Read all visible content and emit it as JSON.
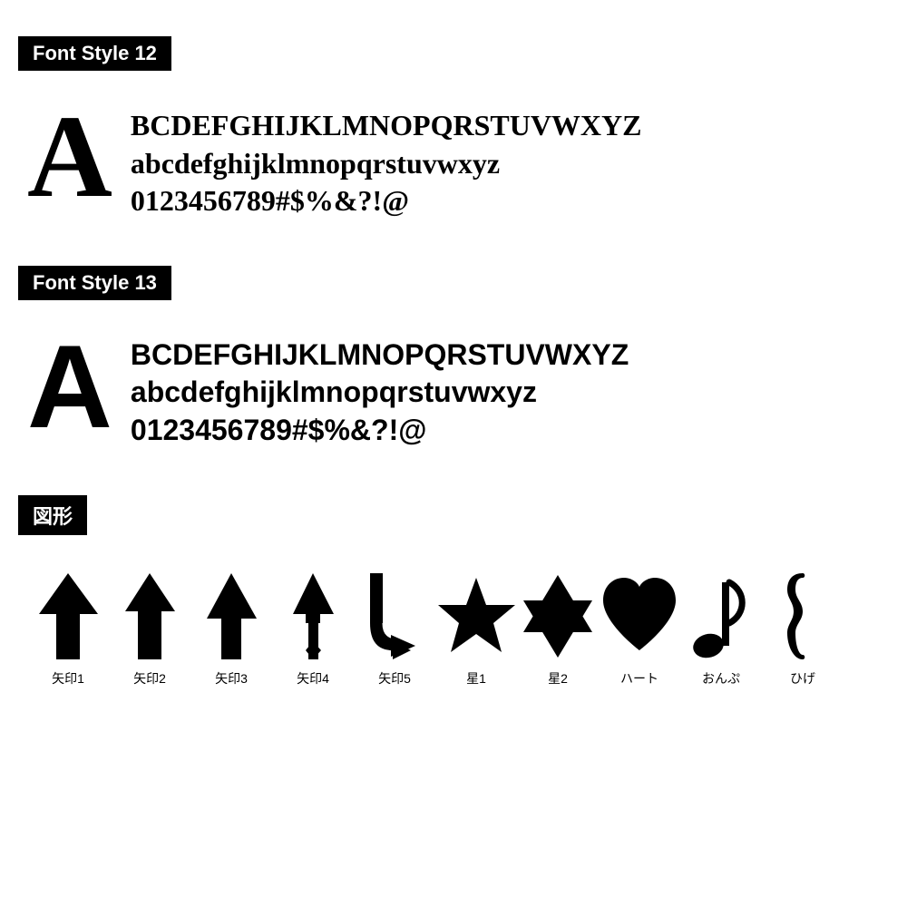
{
  "font_style_12": {
    "label": "Font Style 12",
    "big_letter": "A",
    "lines": [
      "BCDEFGHIJKLMNOPQRSTUVWXYZ",
      "abcdefghijklmnopqrstuvwxyz",
      "0123456789#$%&?!@"
    ]
  },
  "font_style_13": {
    "label": "Font Style 13",
    "big_letter": "A",
    "lines": [
      "BCDEFGHIJKLMNOPQRSTUVWXYZ",
      "abcdefghijklmnopqrstuvwxyz",
      "0123456789#$%&?!@"
    ]
  },
  "shapes": {
    "label": "図形",
    "items": [
      {
        "name": "矢印1",
        "type": "arrow1"
      },
      {
        "name": "矢印2",
        "type": "arrow2"
      },
      {
        "name": "矢印3",
        "type": "arrow3"
      },
      {
        "name": "矢印4",
        "type": "arrow4"
      },
      {
        "name": "矢印5",
        "type": "arrow5"
      },
      {
        "name": "星1",
        "type": "star1"
      },
      {
        "name": "星2",
        "type": "star2"
      },
      {
        "name": "ハート",
        "type": "heart"
      },
      {
        "name": "おんぷ",
        "type": "music"
      },
      {
        "name": "ひげ",
        "type": "moustache"
      }
    ]
  }
}
